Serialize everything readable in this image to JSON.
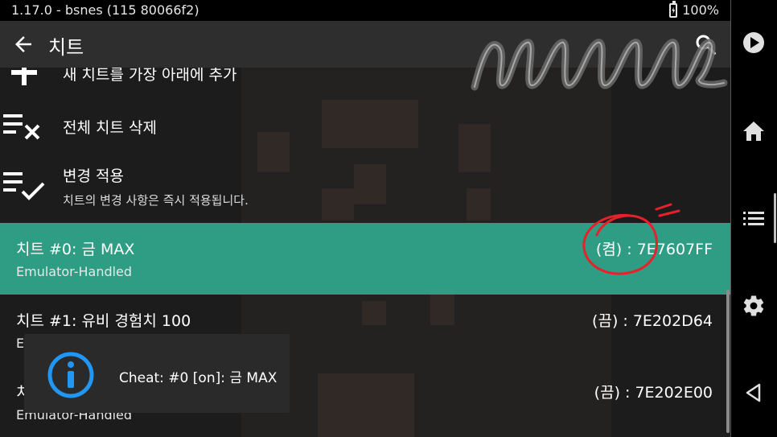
{
  "status_bar": {
    "app_version": "1.17.0 - bsnes (115 80066f2)",
    "battery": "100%"
  },
  "toolbar": {
    "title": "치트",
    "back_icon": "arrow-left-icon",
    "search_icon": "search-icon"
  },
  "menu": {
    "add": {
      "label": "새 치트를 가장 아래에 추가",
      "icon": "plus-icon"
    },
    "delete_all": {
      "label": "전체 치트 삭제",
      "icon": "clear-list-icon"
    },
    "apply": {
      "label": "변경 적용",
      "description": "치트의 변경 사항은 즉시 적용됩니다.",
      "icon": "check-list-icon"
    }
  },
  "cheats": [
    {
      "title": "치트 #0: 금 MAX",
      "type": "Emulator-Handled",
      "code": "(켬) : 7E7607FF",
      "active": true
    },
    {
      "title": "치트 #1: 유비 경험치 100",
      "type": "E",
      "code": "(끔) : 7E202D64",
      "active": false
    },
    {
      "title": "치",
      "type": "Emulator-Handled",
      "code": "(끔) : 7E202E00",
      "active": false
    }
  ],
  "toast": {
    "message": "Cheat: #0 [on]: 금 MAX",
    "icon": "info-icon"
  },
  "nav": {
    "buttons": [
      "play-icon",
      "home-icon",
      "menu-icon",
      "settings-icon",
      "back-triangle-icon"
    ]
  },
  "colors": {
    "accent": "#2f9d84",
    "toolbar": "#2e2e2e",
    "toast_icon": "#2196f3",
    "annotation": "#e8202a"
  }
}
